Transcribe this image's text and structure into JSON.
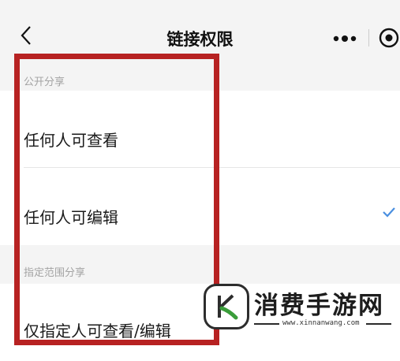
{
  "header": {
    "title": "链接权限",
    "back_icon": "chevron-left-icon",
    "more_icon": "more-dots-icon",
    "close_icon": "target-close-icon"
  },
  "sections": [
    {
      "label": "公开分享",
      "rows": [
        {
          "label": "任何人可查看",
          "selected": false
        },
        {
          "label": "任何人可编辑",
          "selected": true
        }
      ]
    },
    {
      "label": "指定范围分享",
      "rows": [
        {
          "label": "仅指定人可查看/编辑",
          "selected": false
        }
      ]
    }
  ],
  "colors": {
    "highlight": "#b72222",
    "check": "#4a8fe0",
    "watermark_green": "#3a9d3a"
  },
  "watermark": {
    "brand": "消费手游网",
    "url": "www.xinnanwang.com"
  }
}
